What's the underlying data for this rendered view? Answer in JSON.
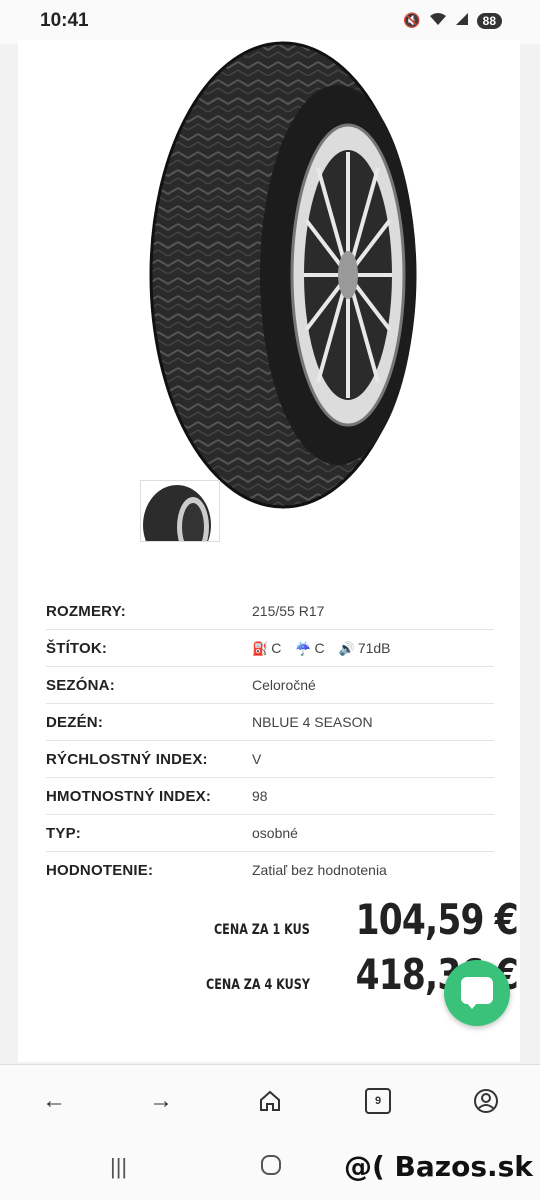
{
  "status_bar": {
    "time": "10:41",
    "battery": "88",
    "icons": [
      "mute-icon",
      "wifi-icon",
      "signal-icon"
    ]
  },
  "specs": [
    {
      "label": "ROZMERY:",
      "value": "215/55 R17"
    },
    {
      "label": "ŠTÍTOK:",
      "value": null
    },
    {
      "label": "SEZÓNA:",
      "value": "Celoročné"
    },
    {
      "label": "DEZÉN:",
      "value": "NBLUE 4 SEASON"
    },
    {
      "label": "RÝCHLOSTNÝ INDEX:",
      "value": "V"
    },
    {
      "label": "HMOTNOSTNÝ INDEX:",
      "value": "98"
    },
    {
      "label": "TYP:",
      "value": "osobné"
    },
    {
      "label": "HODNOTENIE:",
      "value": "Zatiaľ bez hodnotenia"
    }
  ],
  "eu_label": {
    "fuel": "C",
    "wet": "C",
    "noise": "71dB"
  },
  "price": {
    "one_caption": "CENA ZA 1 KUS",
    "one_value": "104,59 €",
    "four_caption": "CENA ZA 4 KUSY",
    "four_value": "418,36 €"
  },
  "browser_nav": {
    "tab_count": "9"
  },
  "watermark": "@( Bazos.sk",
  "colors": {
    "chat_button": "#3ac27a",
    "label_icons": "#2a7dd1"
  }
}
